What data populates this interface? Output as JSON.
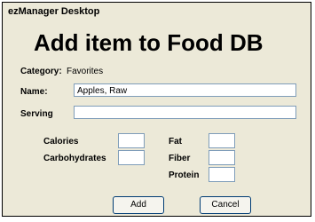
{
  "window": {
    "title": "ezManager Desktop"
  },
  "heading": "Add item to Food DB",
  "category": {
    "label": "Category:",
    "value": "Favorites"
  },
  "name": {
    "label": "Name:",
    "value": "Apples, Raw"
  },
  "serving": {
    "label": "Serving",
    "value": ""
  },
  "nutrients": {
    "calories": {
      "label": "Calories",
      "value": ""
    },
    "carbohydrates": {
      "label": "Carbohydrates",
      "value": ""
    },
    "fat": {
      "label": "Fat",
      "value": ""
    },
    "fiber": {
      "label": "Fiber",
      "value": ""
    },
    "protein": {
      "label": "Protein",
      "value": ""
    }
  },
  "buttons": {
    "add": "Add",
    "cancel": "Cancel"
  }
}
